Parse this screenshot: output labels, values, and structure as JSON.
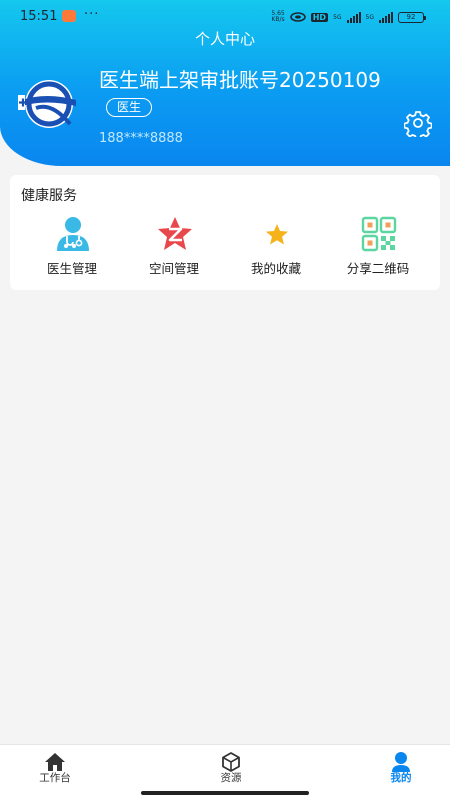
{
  "status_bar": {
    "time": "15:51",
    "dots": "···",
    "net_speed_value": "5.65",
    "net_speed_unit": "KB/s",
    "hd": "HD",
    "signal_1_label": "5G",
    "signal_2_label": "5G",
    "battery": "92"
  },
  "header": {
    "title": "个人中心",
    "user_name": "医生端上架审批账号20250109",
    "role": "医生",
    "phone": "188****8888"
  },
  "health_services": {
    "title": "健康服务",
    "items": [
      {
        "label": "医生管理",
        "icon": "doctor-icon"
      },
      {
        "label": "空间管理",
        "icon": "space-star-icon"
      },
      {
        "label": "我的收藏",
        "icon": "favorite-star-icon"
      },
      {
        "label": "分享二维码",
        "icon": "qr-code-icon"
      }
    ]
  },
  "tab_bar": {
    "items": [
      {
        "label": "工作台",
        "icon": "home-icon",
        "active": false
      },
      {
        "label": "资源",
        "icon": "cube-icon",
        "active": false
      },
      {
        "label": "我的",
        "icon": "person-icon",
        "active": true
      }
    ]
  },
  "colors": {
    "header_gradient_top": "#14c8ee",
    "header_gradient_bottom": "#0a86ef",
    "accent": "#0a86ef",
    "background": "#f4f4f5"
  }
}
